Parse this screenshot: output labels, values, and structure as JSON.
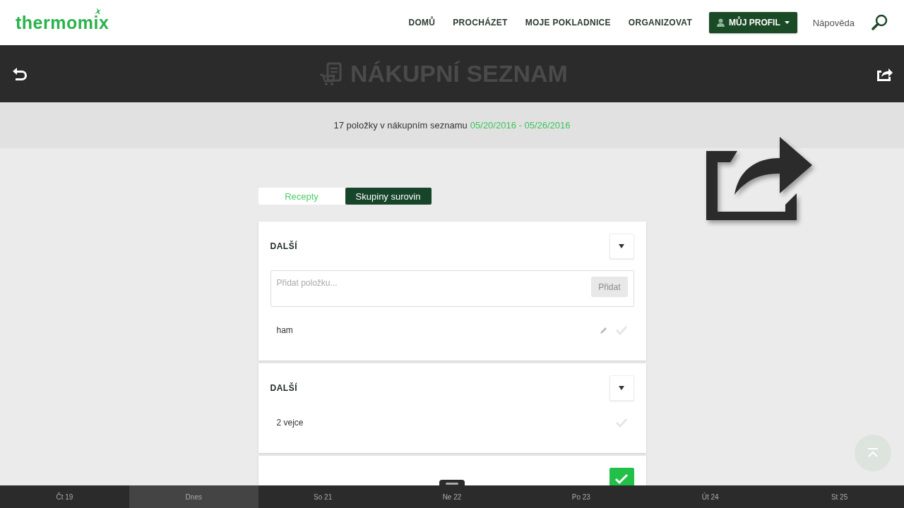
{
  "header": {
    "logo": "thermomix",
    "nav": [
      "DOMŮ",
      "PROCHÁZET",
      "MOJE POKLADNICE",
      "ORGANIZOVAT"
    ],
    "profile": "MŮJ PROFIL",
    "help": "Nápověda"
  },
  "title_bar": {
    "title": "NÁKUPNÍ SEZNAM"
  },
  "summary": {
    "text": "17 položky v nákupním seznamu",
    "dates": "05/20/2016 - 05/26/2016"
  },
  "tabs": [
    {
      "label": "Recepty",
      "selected": false
    },
    {
      "label": "Skupiny surovin",
      "selected": true
    }
  ],
  "groups": [
    {
      "title": "DALŠÍ",
      "input": {
        "placeholder": "Přidat položku...",
        "button": "Přidat"
      },
      "items": [
        {
          "name": "ham",
          "editable": true,
          "checked": false
        }
      ]
    },
    {
      "title": "DALŠÍ",
      "items": [
        {
          "name": "2 vejce",
          "editable": false,
          "checked": false
        }
      ]
    },
    {
      "checked": true
    }
  ],
  "days": [
    {
      "label": "Čt 19",
      "selected": false
    },
    {
      "label": "Dnes",
      "selected": true
    },
    {
      "label": "So 21",
      "selected": false
    },
    {
      "label": "Ne 22",
      "selected": false
    },
    {
      "label": "Po 23",
      "selected": false
    },
    {
      "label": "Út 24",
      "selected": false
    },
    {
      "label": "St 25",
      "selected": false
    }
  ]
}
